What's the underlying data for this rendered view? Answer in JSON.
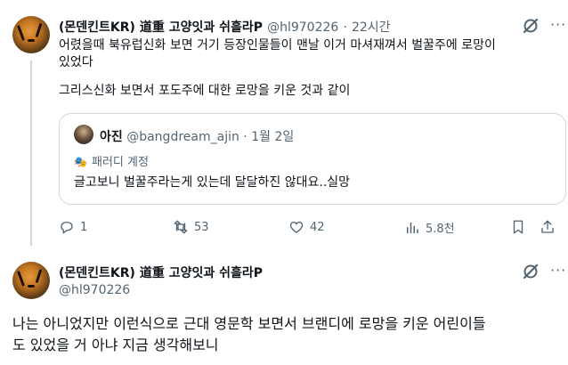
{
  "tweet1": {
    "author_name": "(몬덴킨트KR) 道重 고양잇과 쉬흘라P",
    "handle": "@hl970226",
    "separator": "·",
    "time": "22시간",
    "text_line1": "어렸을때 북유럽신화 보면 거기 등장인물들이 맨날 이거 마셔재껴서 벌꿀주에 로망이",
    "text_line2": "있었다",
    "text_para2": "그리스신화 보면서 포도주에 대한 로망을 키운 것과 같이",
    "quote": {
      "author_name": "아진",
      "handle": "@bangdream_ajin",
      "separator": "·",
      "date": "1월 2일",
      "parody_label": "패러디 계정",
      "text": "글고보니 벌꿀주라는게 있는데 달달하진 않대요..실망"
    },
    "actions": {
      "replies": "1",
      "retweets": "53",
      "likes": "42",
      "views": "5.8천"
    }
  },
  "tweet2": {
    "author_name": "(몬덴킨트KR) 道重 고양잇과 쉬흘라P",
    "handle": "@hl970226",
    "text_line1": "나는 아니었지만 이런식으로 근대 영문학 보면서 브랜디에 로망을 키운 어린이들",
    "text_line2": "도 있었을 거 아냐 지금 생각해보니"
  },
  "icons": {
    "reply": "reply-icon",
    "retweet": "retweet-icon",
    "like": "heart-icon",
    "views": "views-icon",
    "bookmark": "bookmark-icon",
    "share": "share-icon",
    "grok": "grok-icon",
    "more": "more-icon"
  },
  "colors": {
    "text": "#0f1419",
    "secondary": "#536471",
    "border": "#cfd9de"
  }
}
